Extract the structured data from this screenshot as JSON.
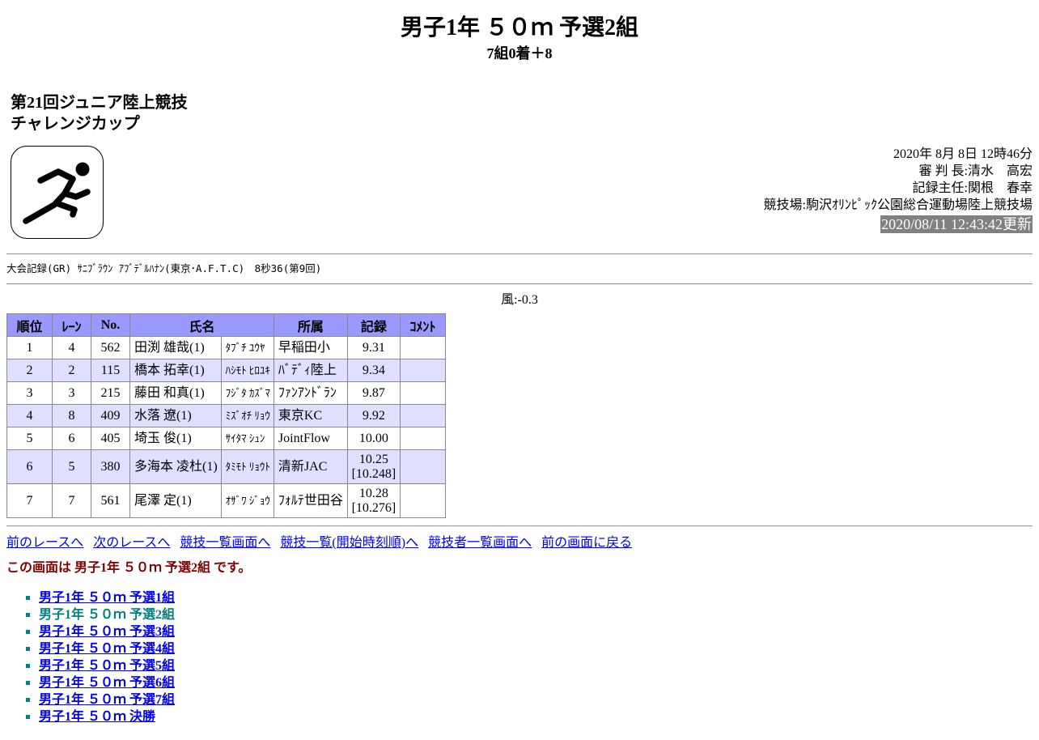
{
  "header": {
    "title": "男子1年 ５０ｍ 予選2組",
    "subtitle": "7組0着＋8"
  },
  "meet": {
    "name_line1": "第21回ジュニア陸上競技",
    "name_line2": "チャレンジカップ"
  },
  "logo": {
    "icon": "runner-pictogram-icon"
  },
  "info": {
    "datetime": "2020年 8月 8日 12時46分",
    "referee": "審 判 長:清水　高宏",
    "recorder": "記録主任:関根　春幸",
    "venue": "競技場:駒沢ｵﾘﾝﾋﾟｯｸ公園総合運動場陸上競技場",
    "updated": "2020/08/11 12:43:42更新"
  },
  "record_line": "大会記録(GR) ｻﾆﾌﾞﾗｳﾝ ｱﾌﾞﾃﾞﾙﾊﾅﾝ(東京･A.F.T.C)　8秒36(第9回)",
  "wind": "風:-0.3",
  "table": {
    "headers": {
      "rank": "順位",
      "lane": "ﾚｰﾝ",
      "no": "No.",
      "name": "氏名",
      "club": "所属",
      "time": "記録",
      "comment": "ｺﾒﾝﾄ"
    },
    "rows": [
      {
        "rank": "1",
        "lane": "4",
        "no": "562",
        "name": "田渕 雄哉(1)",
        "kana": "ﾀﾌﾞﾁ ﾕｳﾔ",
        "club": "早稲田小",
        "time": "9.31",
        "time2": "",
        "comment": ""
      },
      {
        "rank": "2",
        "lane": "2",
        "no": "115",
        "name": "橋本 拓幸(1)",
        "kana": "ﾊｼﾓﾄ ﾋﾛﾕｷ",
        "club": "ﾊﾞﾃﾞｨ陸上",
        "time": "9.34",
        "time2": "",
        "comment": ""
      },
      {
        "rank": "3",
        "lane": "3",
        "no": "215",
        "name": "藤田 和真(1)",
        "kana": "ﾌｼﾞﾀ ｶｽﾞﾏ",
        "club": "ﾌｧﾝｱﾝﾄﾞﾗﾝ",
        "time": "9.87",
        "time2": "",
        "comment": ""
      },
      {
        "rank": "4",
        "lane": "8",
        "no": "409",
        "name": "水落 遼(1)",
        "kana": "ﾐｽﾞｵﾁ ﾘｮｳ",
        "club": "東京KC",
        "time": "9.92",
        "time2": "",
        "comment": ""
      },
      {
        "rank": "5",
        "lane": "6",
        "no": "405",
        "name": "埼玉 俊(1)",
        "kana": "ｻｲﾀﾏ ｼｭﾝ",
        "club": "JointFlow",
        "time": "10.00",
        "time2": "",
        "comment": ""
      },
      {
        "rank": "6",
        "lane": "5",
        "no": "380",
        "name": "多海本 凌杜(1)",
        "kana": "ﾀﾐﾓﾄ ﾘｮｳﾄ",
        "club": "清新JAC",
        "time": "10.25",
        "time2": "[10.248]",
        "comment": ""
      },
      {
        "rank": "7",
        "lane": "7",
        "no": "561",
        "name": "尾澤 定(1)",
        "kana": "ｵｻﾞﾜ ｼﾞｮｳ",
        "club": "ﾌｫﾙﾃ世田谷",
        "time": "10.28",
        "time2": "[10.276]",
        "comment": ""
      }
    ]
  },
  "nav_links": [
    "前のレースへ",
    "次のレースへ",
    "競技一覧画面へ",
    "競技一覧(開始時刻順)へ",
    "競技者一覧画面へ",
    "前の画面に戻る"
  ],
  "current_text": "この画面は 男子1年 ５０ｍ 予選2組 です。",
  "race_list": [
    {
      "label": "男子1年 ５０ｍ 予選1組",
      "active": false
    },
    {
      "label": "男子1年 ５０ｍ 予選2組",
      "active": true
    },
    {
      "label": "男子1年 ５０ｍ 予選3組",
      "active": false
    },
    {
      "label": "男子1年 ５０ｍ 予選4組",
      "active": false
    },
    {
      "label": "男子1年 ５０ｍ 予選5組",
      "active": false
    },
    {
      "label": "男子1年 ５０ｍ 予選6組",
      "active": false
    },
    {
      "label": "男子1年 ５０ｍ 予選7組",
      "active": false
    },
    {
      "label": "男子1年 ５０ｍ 決勝",
      "active": false
    }
  ],
  "colors": {
    "header_bg": "#9999ff",
    "even_row_bg": "#dfdfff",
    "updated_bg": "#808080",
    "current_text": "#800000",
    "bullet": "#008080"
  }
}
